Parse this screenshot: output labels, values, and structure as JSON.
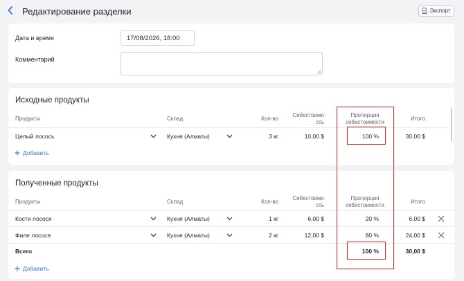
{
  "header": {
    "title": "Редактирование разделки",
    "export_label": "Экспорт"
  },
  "form": {
    "date_label": "Дата и время",
    "date_value": "17/08/2026, 18:00",
    "comment_label": "Комментарий",
    "comment_value": ""
  },
  "source": {
    "title": "Исходные продукты",
    "columns": {
      "product": "Продукты",
      "warehouse": "Склад",
      "qty": "Кол-во",
      "cost_line1": "Себестоимо",
      "cost_line2": "сть",
      "prop_line1": "Пропорция",
      "prop_line2": "себестоимости",
      "total": "Итого"
    },
    "rows": [
      {
        "product": "Целый лосось",
        "warehouse": "Кухня (Алматы)",
        "qty": "3 кг",
        "cost": "10,00 $",
        "prop": "100 %",
        "total": "30,00 $"
      }
    ],
    "add_label": "Добавить"
  },
  "result": {
    "title": "Полученные продукты",
    "columns": {
      "product": "Продукты",
      "warehouse": "Склад",
      "qty": "Кол-во",
      "cost_line1": "Себестоимо",
      "cost_line2": "сть",
      "prop_line1": "Пропорция",
      "prop_line2": "себестоимости",
      "total": "Итого"
    },
    "rows": [
      {
        "product": "Кости лосося",
        "warehouse": "Кухня (Алматы)",
        "qty": "1 кг",
        "cost": "6,00 $",
        "prop": "20 %",
        "total": "6,00 $"
      },
      {
        "product": "Филе лосося",
        "warehouse": "Кухня (Алматы)",
        "qty": "2 кг",
        "cost": "12,00 $",
        "prop": "80 %",
        "total": "24,00 $"
      }
    ],
    "total_row": {
      "label": "Всего",
      "prop": "100 %",
      "total": "30,00 $"
    },
    "add_label": "Добавить"
  },
  "icons": {
    "back": "chevron-left-icon",
    "export": "document-icon",
    "dropdown": "chevron-down-icon",
    "add": "plus-icon",
    "remove": "close-icon",
    "resize": "resize-handle-icon"
  },
  "colors": {
    "accent": "#2f7be0",
    "highlight": "#e0231b",
    "background": "#f2f3f5"
  }
}
